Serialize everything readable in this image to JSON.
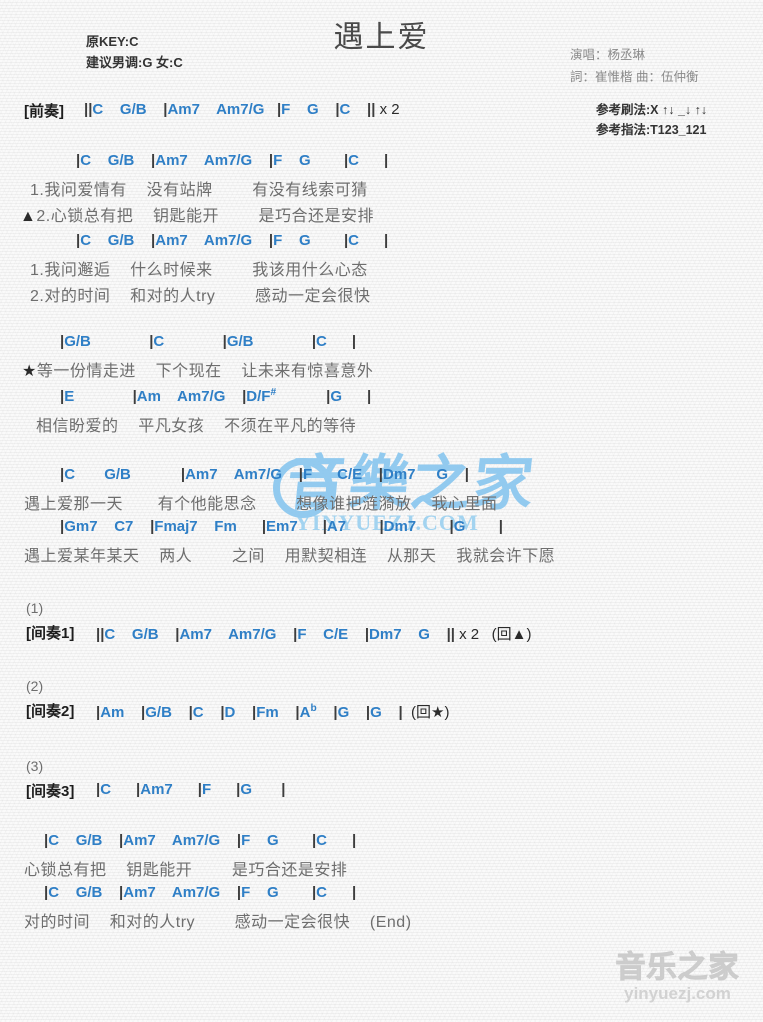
{
  "header": {
    "title": "遇上爱",
    "orig_key": "原KEY:C",
    "suggested_key": "建议男调:G 女:C",
    "singer": "演唱：杨丞琳",
    "writers": "詞：崔惟楷  曲：伍仲衡",
    "strum_pattern": "参考刷法:X ↑↓ _↓ ↑↓",
    "fingerstyle_pattern": "参考指法:T123_121"
  },
  "intro": {
    "label": "[前奏]",
    "chords": "||C    G/B    |Am7    Am7/G   |F    G    |C    || x 2"
  },
  "verse1": {
    "chords_a": "|C    G/B    |Am7    Am7/G    |F    G        |C      |",
    "lyric_a1": "1.我问爱情有    没有站牌        有没有线索可猜",
    "lyric_a2": "▲2.心锁总有把    钥匙能开        是巧合还是安排",
    "chords_b": "|C    G/B    |Am7    Am7/G    |F    G        |C      |",
    "lyric_b1": "1.我问邂逅    什么时候来        我该用什么心态",
    "lyric_b2": "2.对的时间    和对的人try        感动一定会很快"
  },
  "prechorus": {
    "chords_a": "|G/B              |C              |G/B              |C      |",
    "lyric_a": "★等一份情走进    下个现在    让未来有惊喜意外",
    "chords_b": "|E              |Am    Am7/G    |D/F#            |G      |",
    "lyric_b": "相信盼爱的    平凡女孩    不须在平凡的等待"
  },
  "chorus": {
    "chords_a": "|C       G/B            |Am7    Am7/G    |F      C/E    |Dm7     G    |",
    "lyric_a": "遇上爱那一天       有个他能思念        想像谁把涟漪放    我心里面",
    "chords_b": "|Gm7    C7    |Fmaj7    Fm      |Em7      |A7        |Dm7        |G        |",
    "lyric_b": "遇上爱某年某天    两人        之间    用默契相连    从那天    我就会许下愿"
  },
  "interludes": [
    {
      "number": "(1)",
      "label": "[间奏1]",
      "chords": "||C    G/B    |Am7    Am7/G    |F    C/E    |Dm7    G    || x 2   (回▲)"
    },
    {
      "number": "(2)",
      "label": "[间奏2]",
      "chords": "|Am    |G/B    |C    |D    |Fm    |Ab    |G    |G    |  (回★)"
    },
    {
      "number": "(3)",
      "label": "[间奏3]",
      "chords": "|C      |Am7      |F      |G       |"
    }
  ],
  "outro": {
    "chords_a": "|C    G/B    |Am7    Am7/G    |F    G        |C      |",
    "lyric_a": "心锁总有把    钥匙能开        是巧合还是安排",
    "chords_b": "|C    G/B    |Am7    Am7/G    |F    G        |C      |",
    "lyric_b": "对的时间    和对的人try        感动一定会很快    (End)"
  },
  "watermark": {
    "center_text": "音樂之家",
    "center_url": "YINYUEZJ.COM",
    "bottom_text": "音乐之家",
    "bottom_url": "yinyuezj.com"
  },
  "colors": {
    "chord": "#2f7fc6",
    "lyric": "#6e6e6e",
    "bar": "#3d3d3d",
    "title": "#4a4a4a",
    "credits": "#8a8a8a",
    "watermark_center": "#8dc8ef",
    "watermark_bottom": "#d2d2d2"
  }
}
